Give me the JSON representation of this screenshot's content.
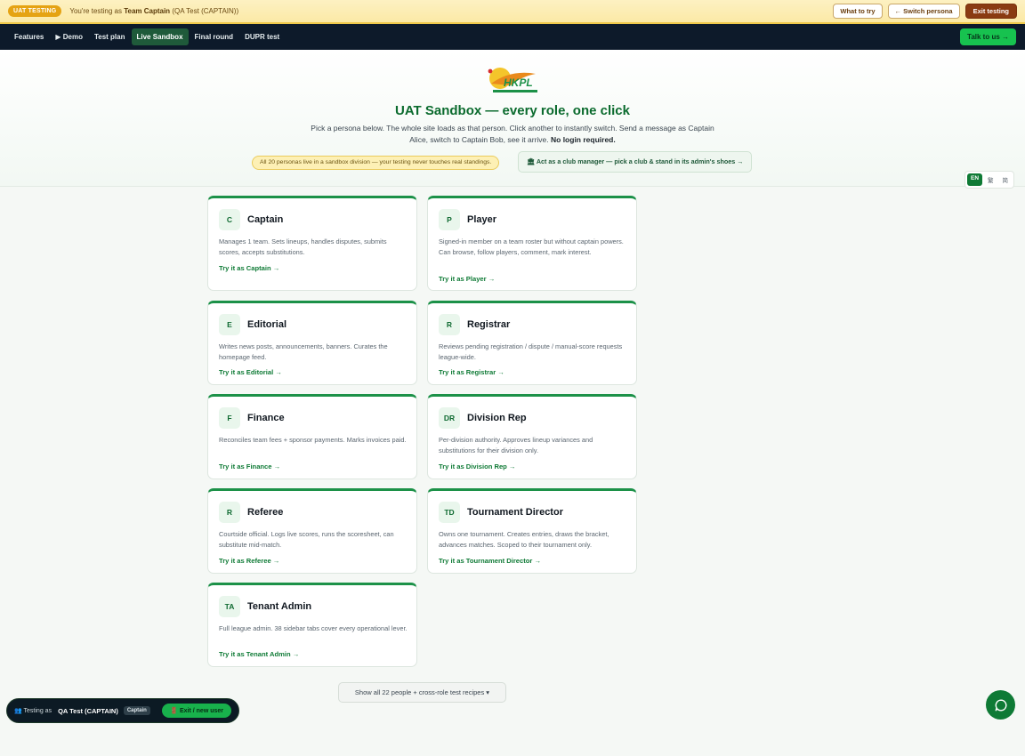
{
  "banner": {
    "badge": "UAT TESTING",
    "text_prefix": "You're testing as",
    "persona": "Team Captain",
    "persona_detail": "(QA Test (CAPTAIN))",
    "what_to_try": "What to try",
    "switch_persona": "← Switch persona",
    "exit_testing": "Exit testing"
  },
  "nav": {
    "items": [
      "Features",
      "▶ Demo",
      "Test plan",
      "Live Sandbox",
      "Final round",
      "DUPR test"
    ],
    "active": "Live Sandbox",
    "cta": "Talk to us →"
  },
  "hero": {
    "logo_text": "HKPL",
    "title": "UAT Sandbox — every role, one click",
    "subtitle": "Pick a persona below. The whole site loads as that person. Click another to instantly switch. Send a message as Captain Alice, switch to Captain Bob, see it arrive.",
    "subtitle_bold": "No login required.",
    "sandbox_note": "All 20 personas live in a sandbox division — your testing never touches real standings.",
    "club_manager": "🏛 Act as a club manager — pick a club & stand in its admin's shoes →"
  },
  "lang": {
    "en": "EN",
    "trad": "繁",
    "simp": "简"
  },
  "personas": [
    {
      "initials": "C",
      "title": "Captain",
      "desc": "Manages 1 team. Sets lineups, handles disputes, submits scores, accepts substitutions.",
      "link": "Try it as Captain →"
    },
    {
      "initials": "P",
      "title": "Player",
      "desc": "Signed-in member on a team roster but without captain powers. Can browse, follow players, comment, mark interest.",
      "link": "Try it as Player →"
    },
    {
      "initials": "E",
      "title": "Editorial",
      "desc": "Writes news posts, announcements, banners. Curates the homepage feed.",
      "link": "Try it as Editorial →"
    },
    {
      "initials": "R",
      "title": "Registrar",
      "desc": "Reviews pending registration / dispute / manual-score requests league-wide.",
      "link": "Try it as Registrar →"
    },
    {
      "initials": "F",
      "title": "Finance",
      "desc": "Reconciles team fees + sponsor payments. Marks invoices paid.",
      "link": "Try it as Finance →"
    },
    {
      "initials": "DR",
      "title": "Division Rep",
      "desc": "Per-division authority. Approves lineup variances and substitutions for their division only.",
      "link": "Try it as Division Rep →"
    },
    {
      "initials": "R",
      "title": "Referee",
      "desc": "Courtside official. Logs live scores, runs the scoresheet, can substitute mid-match.",
      "link": "Try it as Referee →"
    },
    {
      "initials": "TD",
      "title": "Tournament Director",
      "desc": "Owns one tournament. Creates entries, draws the bracket, advances matches. Scoped to their tournament only.",
      "link": "Try it as Tournament Director →"
    },
    {
      "initials": "TA",
      "title": "Tenant Admin",
      "desc": "Full league admin. 38 sidebar tabs cover every operational lever.",
      "link": "Try it as Tenant Admin →"
    }
  ],
  "show_all": "Show all 22 people + cross-role test recipes ▾",
  "testing_bar": {
    "label": "👥 Testing as",
    "name": "QA Test (CAPTAIN)",
    "role": "Captain",
    "exit": "🚪 Exit / new user"
  },
  "colors": {
    "accent": "#0e7a35",
    "banner": "#fbe9a6",
    "nav": "#0d1a2a",
    "cta": "#17c24f"
  }
}
